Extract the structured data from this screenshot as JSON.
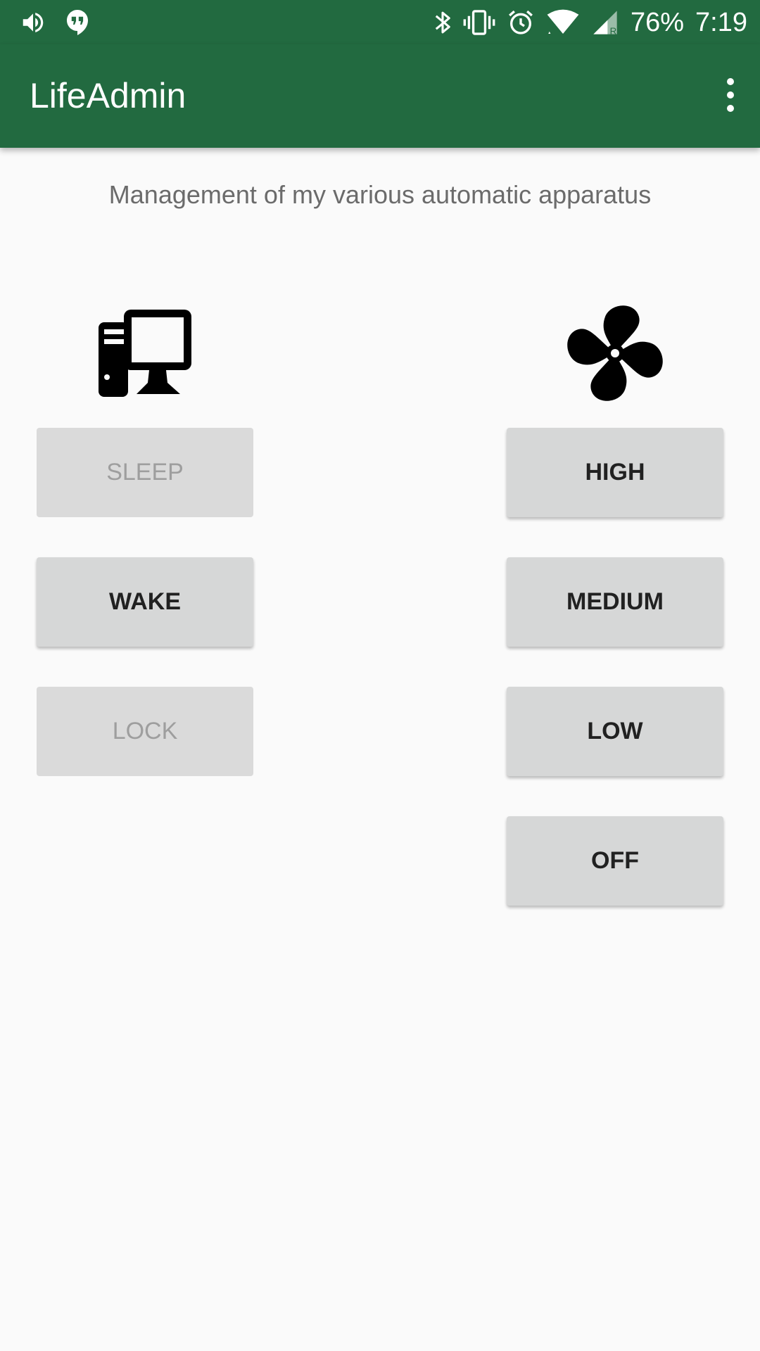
{
  "status_bar": {
    "battery": "76%",
    "time": "7:19",
    "left_icons": [
      "volume-icon",
      "hangouts-icon"
    ],
    "right_icons": [
      "bluetooth-icon",
      "vibrate-icon",
      "alarm-icon",
      "wifi-icon",
      "cell-signal-icon"
    ],
    "roaming_indicator": "R"
  },
  "app_bar": {
    "title": "LifeAdmin",
    "menu_icon": "more-vert-icon"
  },
  "main": {
    "subtitle": "Management of my various automatic apparatus",
    "computer": {
      "icon": "desktop-computer-icon",
      "buttons": [
        {
          "label": "SLEEP",
          "enabled": false
        },
        {
          "label": "WAKE",
          "enabled": true
        },
        {
          "label": "LOCK",
          "enabled": false
        }
      ]
    },
    "fan": {
      "icon": "fan-icon",
      "buttons": [
        {
          "label": "HIGH",
          "enabled": true
        },
        {
          "label": "MEDIUM",
          "enabled": true
        },
        {
          "label": "LOW",
          "enabled": true
        },
        {
          "label": "OFF",
          "enabled": true
        }
      ]
    }
  },
  "colors": {
    "primary": "#226a40",
    "background": "#fafafa",
    "button": "#d6d7d7",
    "button_text": "#212121",
    "disabled_text": "#9e9e9e",
    "subtitle_text": "#6b6b6b"
  }
}
